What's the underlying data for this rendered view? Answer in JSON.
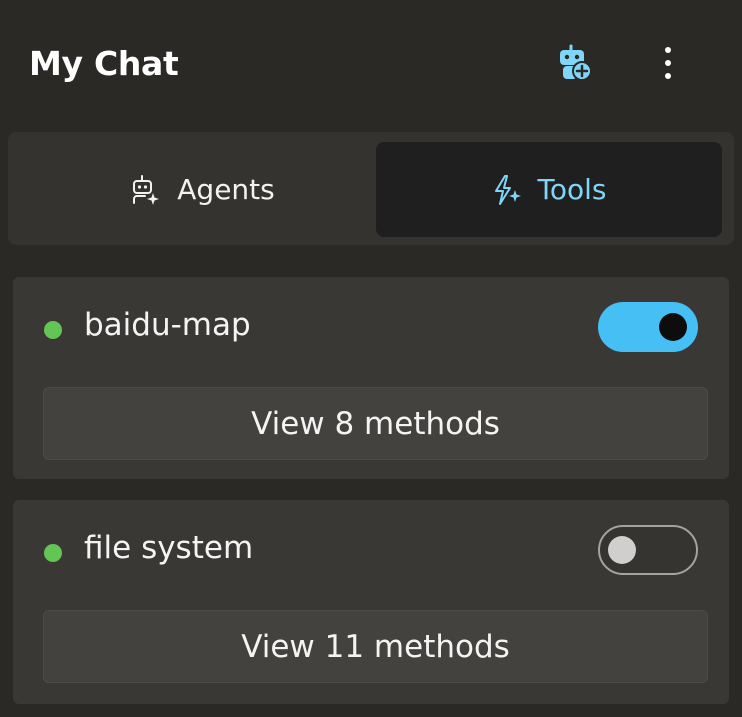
{
  "header": {
    "title": "My Chat",
    "actions": [
      {
        "icon": "robot-add-icon",
        "color": "#7fd6f7"
      },
      {
        "icon": "more-vertical-icon",
        "color": "#ffffff"
      }
    ]
  },
  "tabs": {
    "selected": "Tools",
    "items": [
      {
        "label": "Agents",
        "icon": "agent-sparkle-icon"
      },
      {
        "label": "Tools",
        "icon": "flash-sparkle-icon",
        "accent": "#7fd6f7"
      }
    ]
  },
  "tools": [
    {
      "name": "baidu-map",
      "status_color": "#62c554",
      "enabled": true,
      "methods_label": "View 8 methods"
    },
    {
      "name": "file system",
      "status_color": "#62c554",
      "enabled": false,
      "methods_label": "View 11 methods"
    }
  ],
  "colors": {
    "toggle_on": "#46bff5",
    "status_dot": "#62c554",
    "accent": "#7fd6f7"
  }
}
